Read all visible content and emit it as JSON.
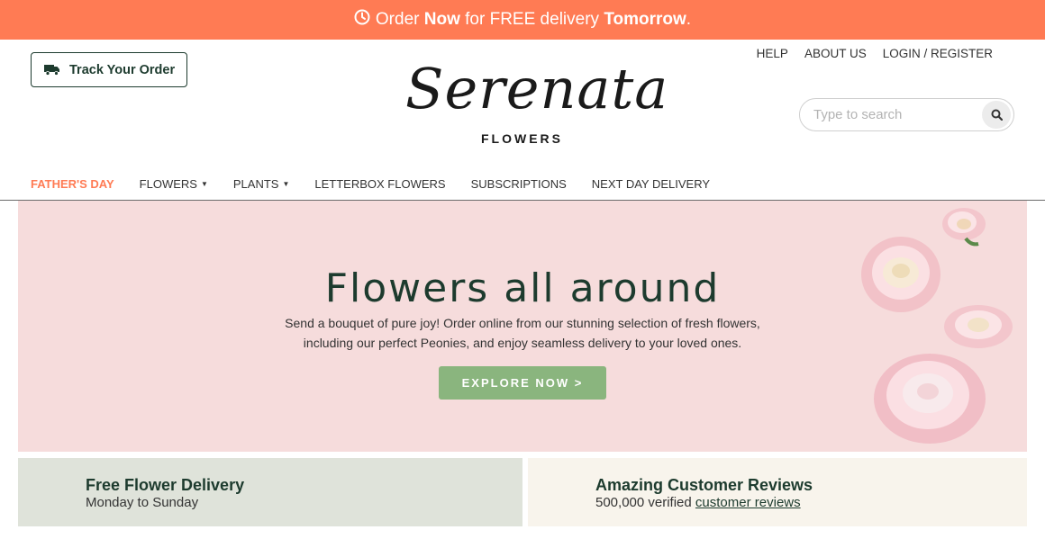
{
  "promo": {
    "part1": "Order ",
    "part2": "Now",
    "part3": " for FREE delivery ",
    "part4": "Tomorrow",
    "part5": "."
  },
  "header": {
    "track_order": "Track Your Order",
    "logo_script": "Serenata",
    "logo_sub": "FLOWERS",
    "top_links": [
      "HELP",
      "ABOUT US",
      "LOGIN / REGISTER"
    ],
    "search_placeholder": "Type to search"
  },
  "nav": {
    "items": [
      {
        "label": "FATHER'S DAY",
        "dropdown": false
      },
      {
        "label": "FLOWERS",
        "dropdown": true
      },
      {
        "label": "PLANTS",
        "dropdown": true
      },
      {
        "label": "LETTERBOX FLOWERS",
        "dropdown": false
      },
      {
        "label": "SUBSCRIPTIONS",
        "dropdown": false
      },
      {
        "label": "NEXT DAY DELIVERY",
        "dropdown": false
      }
    ]
  },
  "hero": {
    "title": "Flowers all around",
    "desc_line1": "Send a bouquet of pure joy! Order online from our stunning selection of fresh flowers,",
    "desc_line2": "including our perfect Peonies, and enjoy seamless delivery to your loved ones.",
    "cta": "EXPLORE NOW >"
  },
  "features": {
    "delivery_title": "Free Flower Delivery",
    "delivery_sub": "Monday to Sunday",
    "reviews_title": "Amazing Customer Reviews",
    "reviews_prefix": "500,000 verified ",
    "reviews_link": "customer reviews"
  },
  "colors": {
    "promo_bg": "#ff7b54",
    "hero_bg": "#f6dcdc",
    "cta_bg": "#8ab57e",
    "brand_dark": "#1d3b2e"
  }
}
